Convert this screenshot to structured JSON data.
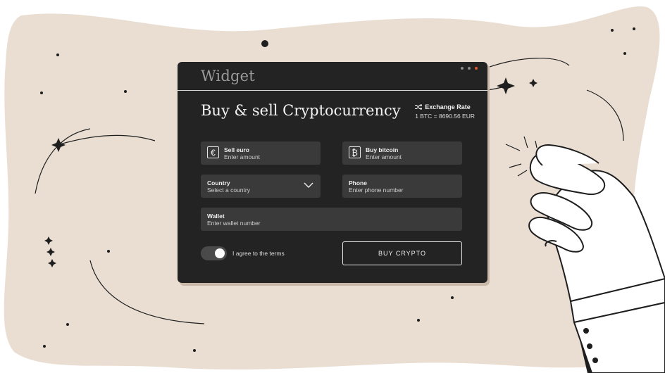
{
  "window": {
    "title": "Widget",
    "dots": [
      "gray",
      "gray",
      "red"
    ]
  },
  "heading": "Buy & sell Cryptocurrency",
  "exchange": {
    "title": "Exchange Rate",
    "value": "1 BTC = 8690.56 EUR",
    "icon": "shuffle-icon"
  },
  "form": {
    "sell": {
      "label": "Sell euro",
      "placeholder": "Enter amount",
      "symbol": "€"
    },
    "buy": {
      "label": "Buy bitcoin",
      "placeholder": "Enter amount",
      "symbol": "₿"
    },
    "country": {
      "label": "Country",
      "placeholder": "Select a country"
    },
    "phone": {
      "label": "Phone",
      "placeholder": "Enter phone number"
    },
    "wallet": {
      "label": "Wallet",
      "placeholder": "Enter wallet number"
    },
    "terms": {
      "label": "I agree to the terms",
      "checked": true
    },
    "submit": "BUY CRYPTO"
  },
  "colors": {
    "background": "#eaded3",
    "widget": "#232323",
    "field": "#3a3a3a",
    "accent_dot": "#e2572e"
  }
}
